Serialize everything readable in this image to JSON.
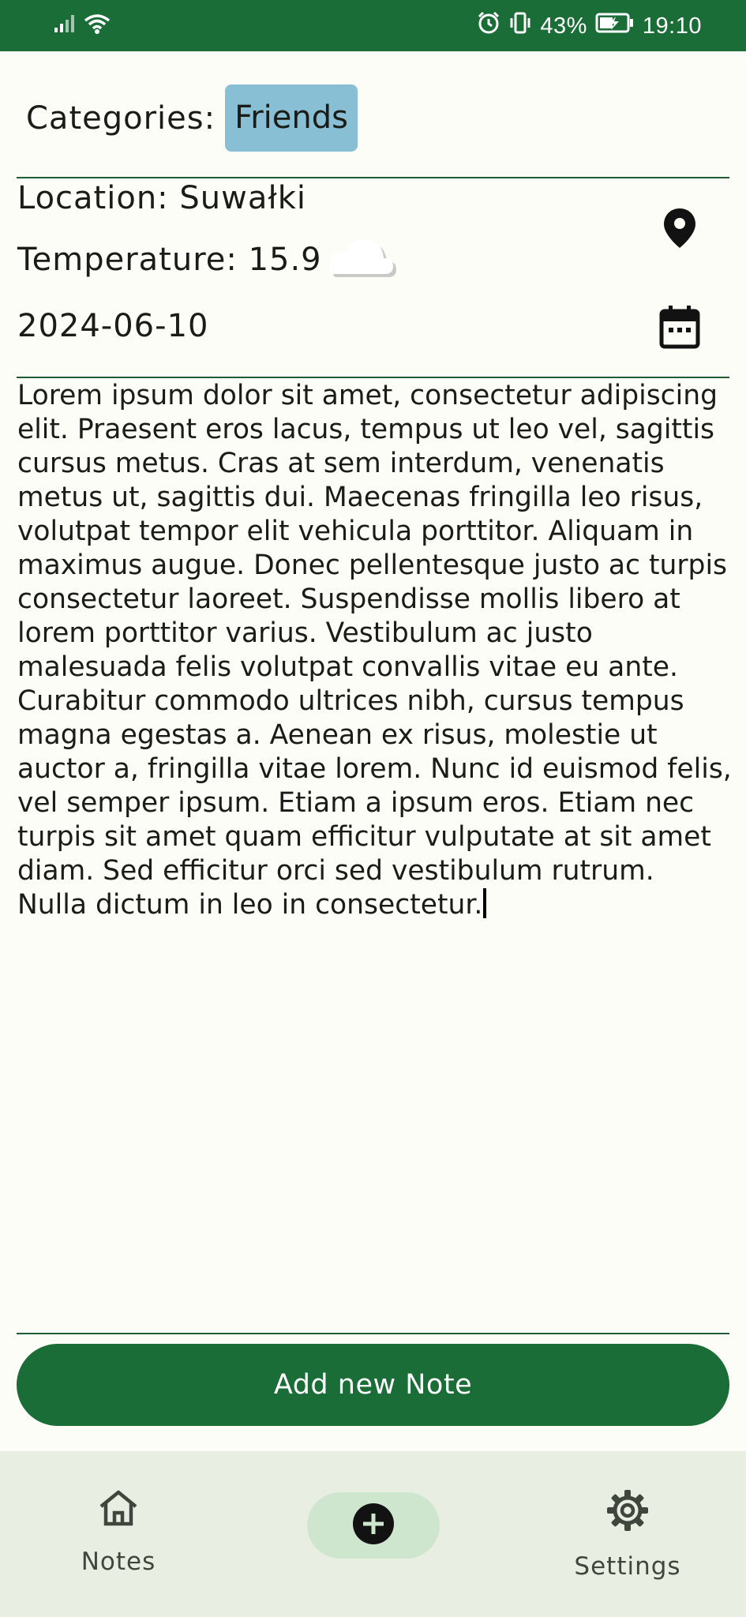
{
  "status_bar": {
    "battery_percent": "43%",
    "time": "19:10",
    "icons": [
      "signal-icon",
      "wifi-icon",
      "alarm-icon",
      "vibrate-icon",
      "battery-charging-icon"
    ]
  },
  "note": {
    "categories_label": "Categories:",
    "category_chip": "Friends",
    "location": "Location: Suwałki",
    "temperature": "Temperature: 15.9",
    "weather_icon": "cloud-icon",
    "date": "2024-06-10",
    "body": "Lorem ipsum dolor sit amet, consectetur adipiscing elit. Praesent eros lacus, tempus ut leo vel, sagittis cursus metus. Cras at sem interdum, venenatis metus ut, sagittis dui. Maecenas fringilla leo risus, volutpat tempor elit vehicula porttitor. Aliquam in maximus augue. Donec pellentesque justo ac turpis consectetur laoreet. Suspendisse mollis libero at lorem porttitor varius. Vestibulum ac justo malesuada felis volutpat convallis vitae eu ante. Curabitur commodo ultrices nibh, cursus tempus magna egestas a. Aenean ex risus, molestie ut auctor a, fringilla vitae lorem. Nunc id euismod felis, vel semper ipsum. Etiam a ipsum eros. Etiam nec turpis sit amet quam efficitur vulputate at sit amet diam. Sed efficitur orci sed vestibulum rutrum. Nulla dictum in leo in consectetur."
  },
  "actions": {
    "add_note_label": "Add new Note"
  },
  "bottom_nav": {
    "notes_label": "Notes",
    "settings_label": "Settings"
  },
  "colors": {
    "primary": "#1a6d36",
    "chip": "#89bfd4",
    "background": "#fcfdf7",
    "nav_background": "#e9eee3",
    "nav_active_pill": "#cfe6ce"
  }
}
